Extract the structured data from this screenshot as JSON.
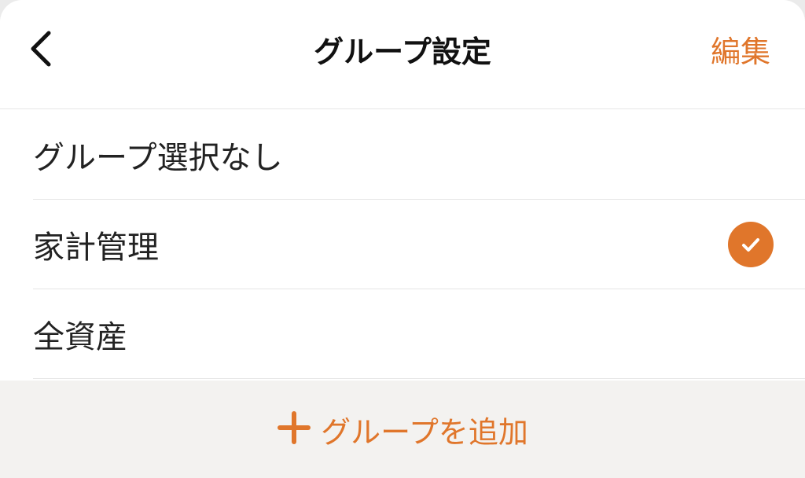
{
  "header": {
    "back_icon": "chevron-left-icon",
    "title": "グループ設定",
    "edit_label": "編集"
  },
  "groups": [
    {
      "label": "グループ選択なし",
      "selected": false
    },
    {
      "label": "家計管理",
      "selected": true
    },
    {
      "label": "全資産",
      "selected": false
    }
  ],
  "footer": {
    "add_icon": "plus-icon",
    "add_label": "グループを追加"
  },
  "colors": {
    "accent": "#e0762b",
    "footer_bg": "#f3f2f0"
  }
}
